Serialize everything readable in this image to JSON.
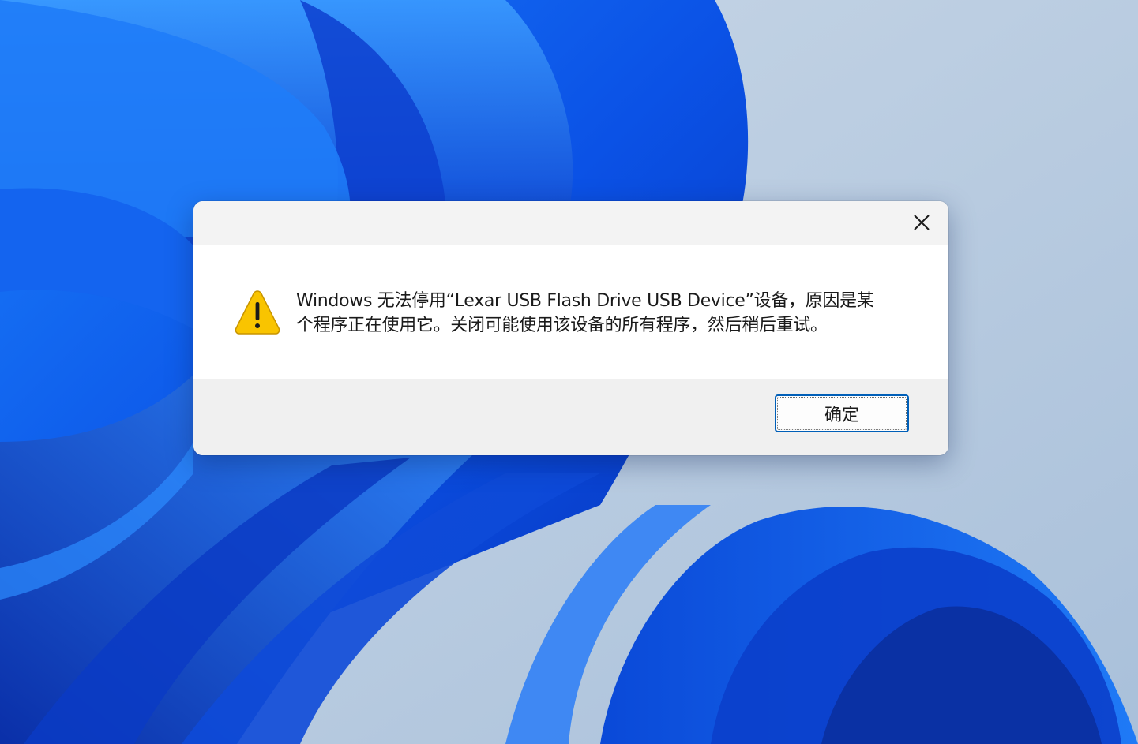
{
  "dialog": {
    "message_line1": "Windows 无法停用“Lexar USB Flash Drive USB Device”设备，原因是某",
    "message_line2": "个程序正在使用它。关闭可能使用该设备的所有程序，然后稍后重试。",
    "ok_label": "确定",
    "icons": {
      "warning": "warning-icon",
      "close": "close-icon"
    }
  },
  "colors": {
    "accent_border": "#005fb8",
    "warning_yellow": "#f9c400",
    "wallpaper_blue": "#0a3fd8",
    "wallpaper_bg": "#b9cce0"
  }
}
